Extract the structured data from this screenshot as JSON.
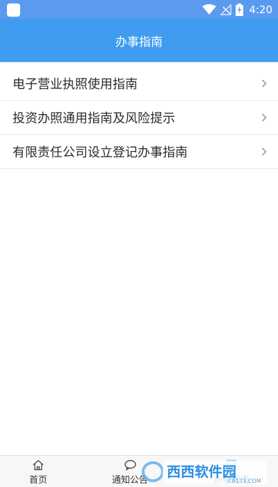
{
  "status_bar": {
    "time": "4:20",
    "icons": [
      "app-icon",
      "wifi-icon",
      "no-signal-icon",
      "battery-charging-icon"
    ]
  },
  "header": {
    "title": "办事指南"
  },
  "list": {
    "items": [
      {
        "label": "电子营业执照使用指南"
      },
      {
        "label": "投资办照通用指南及风险提示"
      },
      {
        "label": "有限责任公司设立登记办事指南"
      }
    ]
  },
  "bottom_nav": {
    "items": [
      {
        "label": "首页",
        "icon": "home-icon"
      },
      {
        "label": "通知公告",
        "icon": "chat-bubble-icon"
      },
      {
        "label": "办事指南",
        "icon": "guide-icon",
        "active": true
      }
    ]
  },
  "watermark": {
    "text": "西西软件园",
    "subtext": "CR173.COM"
  },
  "colors": {
    "accent": "#3f9cf0",
    "status_bar": "#5a9bf0"
  }
}
